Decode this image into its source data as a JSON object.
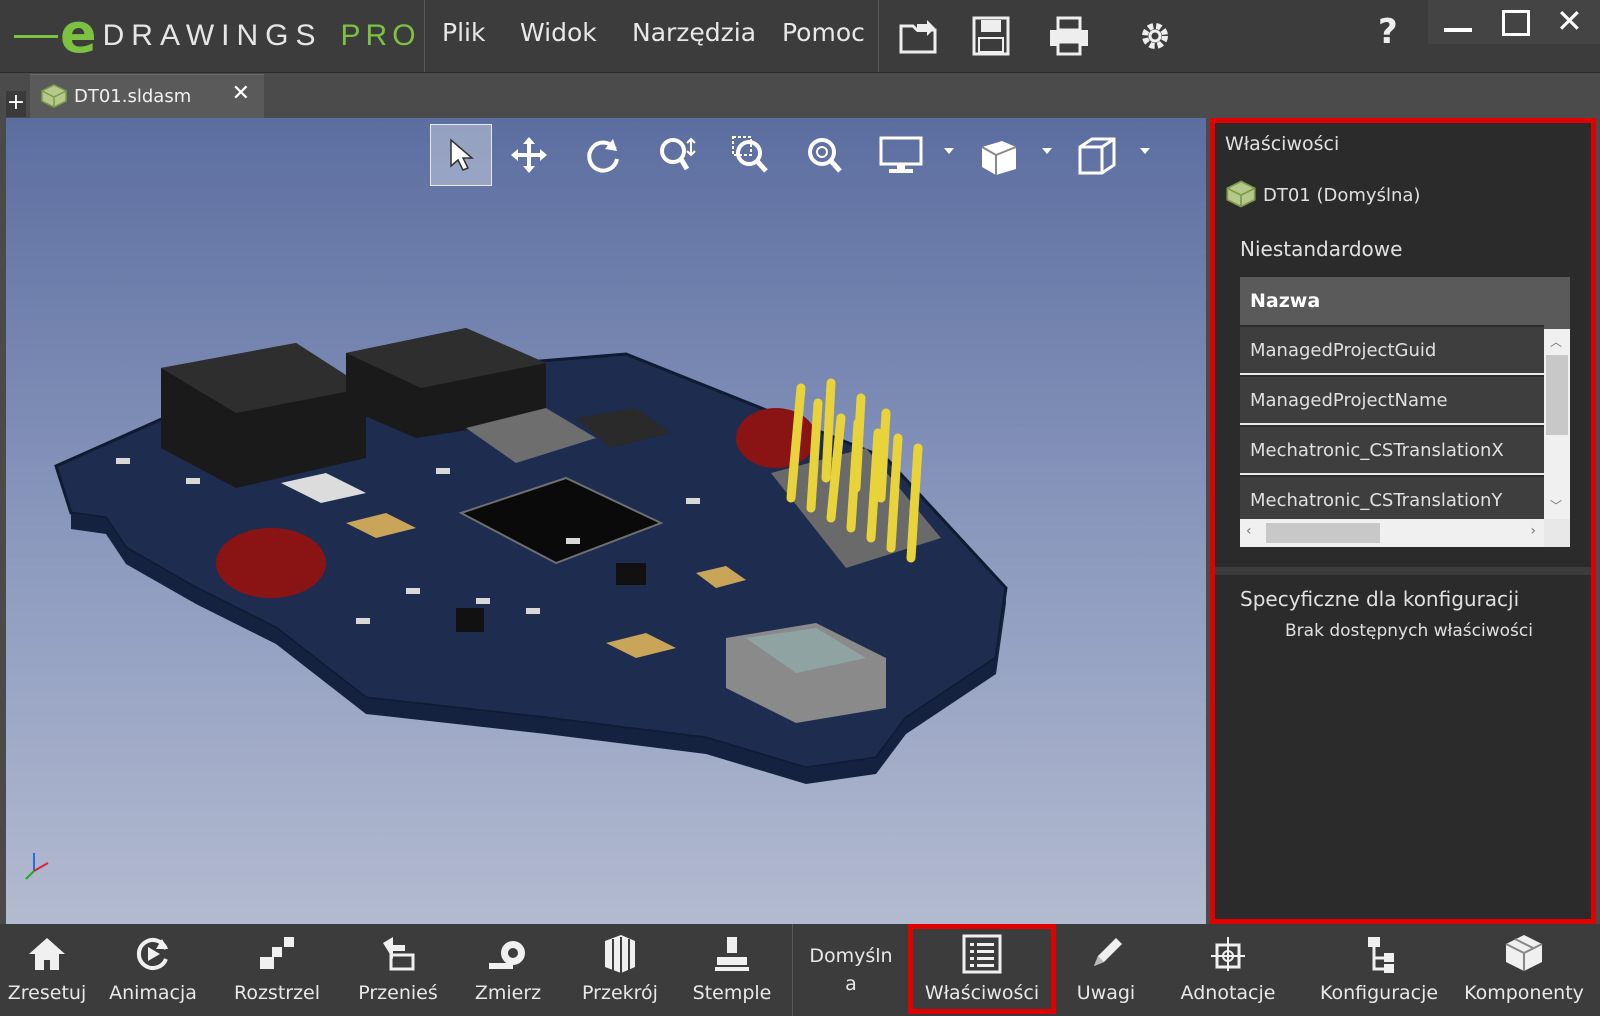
{
  "app": {
    "logo_letter": "e",
    "brand": "DRAWINGS",
    "edition": "PRO",
    "menu": [
      "Plik",
      "Widok",
      "Narzędzia",
      "Pomoc"
    ],
    "help": "?"
  },
  "tabs": {
    "new": "+",
    "active": {
      "label": "DT01.sldasm",
      "close": "✕"
    }
  },
  "view_toolbar": [
    "select",
    "pan",
    "rotate",
    "zoom",
    "zoom-to-area",
    "zoom-to-fit",
    "display-style",
    "view-orientation",
    "standard-views"
  ],
  "properties_panel": {
    "title": "Właściwości",
    "document": "DT01 (Domyślna)",
    "custom_section": "Niestandardowe",
    "table_header": "Nazwa",
    "rows": [
      "ManagedProjectGuid",
      "ManagedProjectName",
      "Mechatronic_CSTranslationX",
      "Mechatronic_CSTranslationY"
    ],
    "config_section": "Specyficzne dla konfiguracji",
    "config_empty": "Brak dostępnych właściwości"
  },
  "bottom_toolbar": {
    "reset": "Zresetuj",
    "animation": "Animacja",
    "explode": "Rozstrzel",
    "move": "Przenieś",
    "measure": "Zmierz",
    "section": "Przekrój",
    "stamps": "Stemple",
    "config_line1": "Domyśln",
    "config_line2": "a",
    "properties": "Właściwości",
    "notes": "Uwagi",
    "annotations": "Adnotacje",
    "configurations": "Konfiguracje",
    "components": "Komponenty"
  },
  "colors": {
    "accent_green": "#7cc142",
    "highlight_red": "#e00000",
    "pcb_blue": "#1d2c4f"
  }
}
